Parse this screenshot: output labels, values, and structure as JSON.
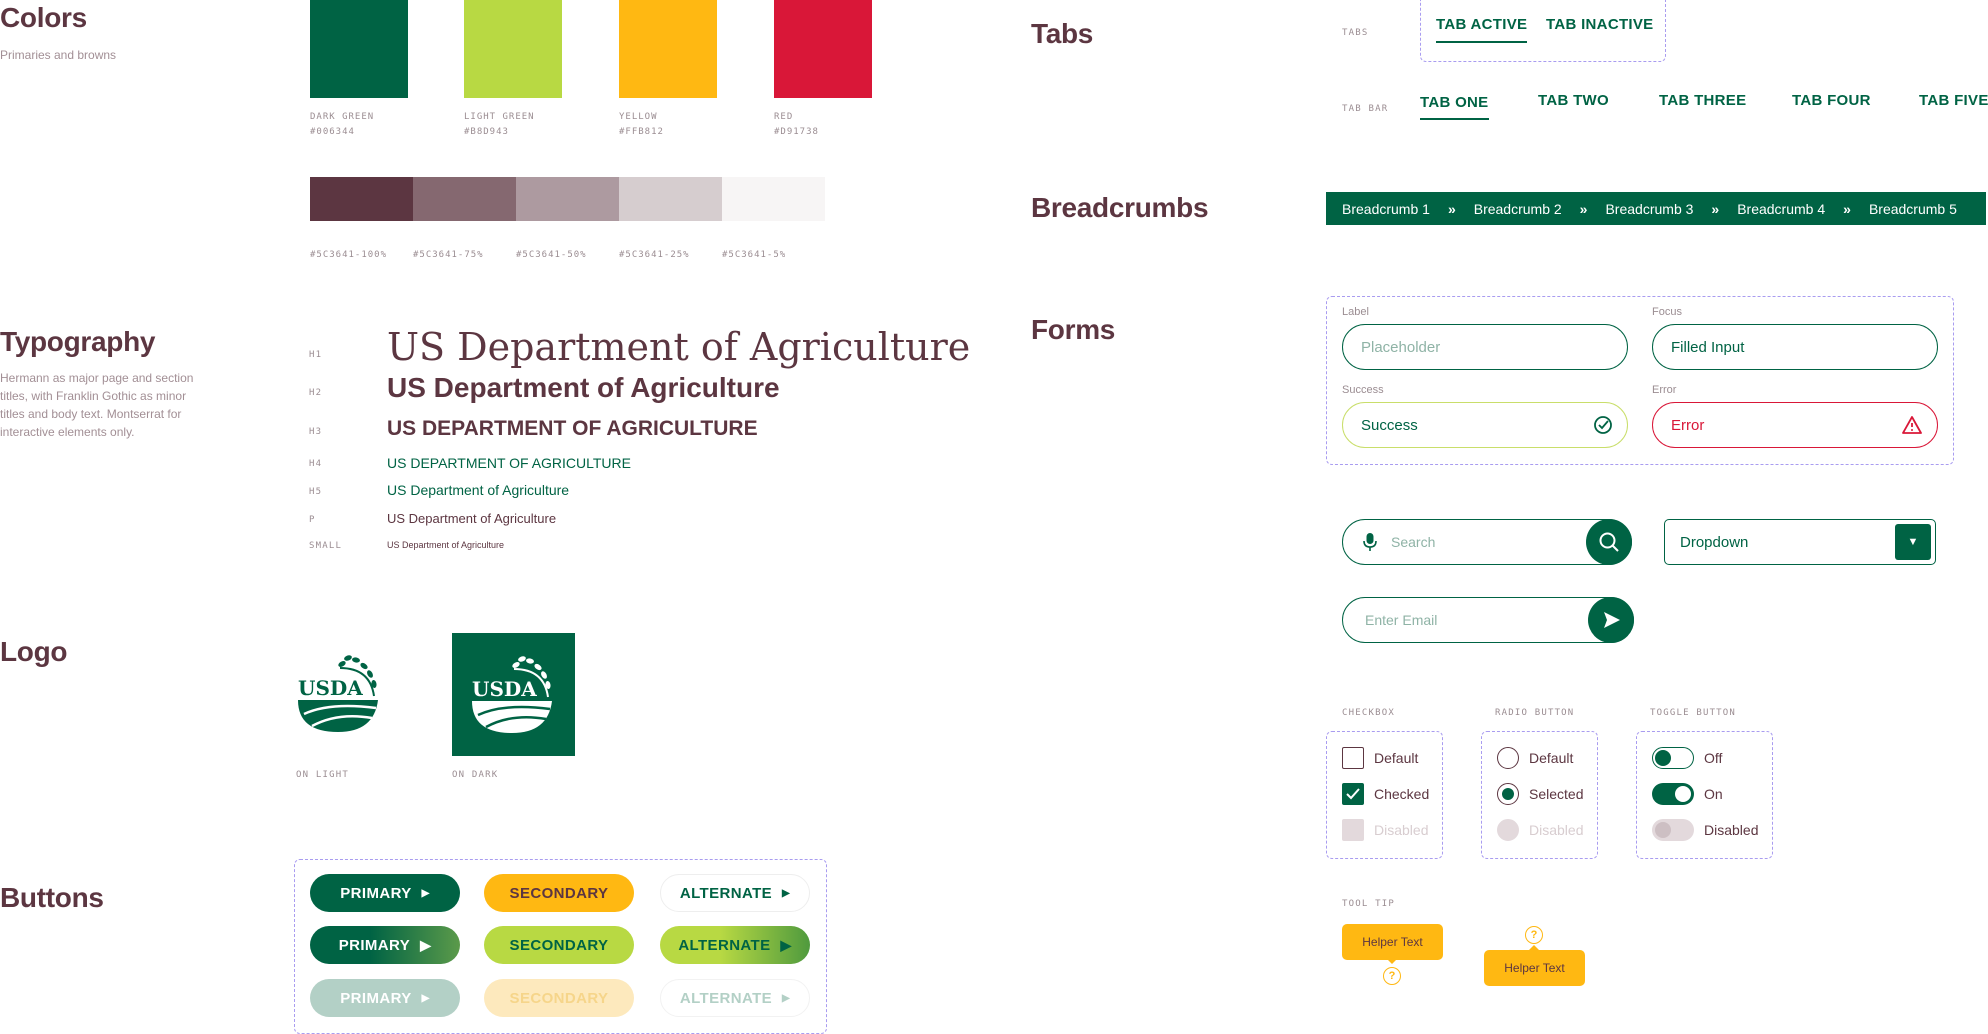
{
  "colors_section": {
    "title": "Colors",
    "subtitle": "Primaries and browns",
    "swatches": [
      {
        "name": "DARK GREEN",
        "hex": "#006344"
      },
      {
        "name": "LIGHT GREEN",
        "hex": "#B8D943"
      },
      {
        "name": "YELLOW",
        "hex": "#FFB812"
      },
      {
        "name": "RED",
        "hex": "#D91738"
      }
    ],
    "browns": [
      {
        "label": "#5C3641-100%",
        "color": "#5C3641"
      },
      {
        "label": "#5C3641-75%",
        "color": "#856870"
      },
      {
        "label": "#5C3641-50%",
        "color": "#ad9aa0"
      },
      {
        "label": "#5C3641-25%",
        "color": "#d6cdcf"
      },
      {
        "label": "#5C3641-5%",
        "color": "#f7f5f5"
      }
    ]
  },
  "typography": {
    "title": "Typography",
    "description": "Hermann as major page and section titles, with Franklin Gothic as minor titles and body text. Montserrat for interactive elements only.",
    "samples": [
      {
        "tag": "H1",
        "text": "US Department of Agriculture"
      },
      {
        "tag": "H2",
        "text": "US Department of Agriculture"
      },
      {
        "tag": "H3",
        "text": "US DEPARTMENT OF AGRICULTURE"
      },
      {
        "tag": "H4",
        "text": "US DEPARTMENT OF AGRICULTURE"
      },
      {
        "tag": "H5",
        "text": "US Department of Agriculture"
      },
      {
        "tag": "P",
        "text": "US Department of Agriculture"
      },
      {
        "tag": "SMALL",
        "text": "US Department of Agriculture"
      }
    ]
  },
  "logo": {
    "title": "Logo",
    "wordmark": "USDA",
    "on_light": "ON LIGHT",
    "on_dark": "ON DARK"
  },
  "buttons": {
    "title": "Buttons",
    "primary": "PRIMARY",
    "secondary": "SECONDARY",
    "alternate": "ALTERNATE"
  },
  "tabs": {
    "title": "Tabs",
    "tabs_label": "TABS",
    "tab_active": "TAB ACTIVE",
    "tab_inactive": "TAB INACTIVE",
    "tabbar_label": "TAB BAR",
    "tabbar": [
      "TAB ONE",
      "TAB TWO",
      "TAB THREE",
      "TAB FOUR",
      "TAB FIVE"
    ]
  },
  "breadcrumbs": {
    "title": "Breadcrumbs",
    "items": [
      "Breadcrumb 1",
      "Breadcrumb 2",
      "Breadcrumb 3",
      "Breadcrumb 4",
      "Breadcrumb 5"
    ],
    "separator": "»"
  },
  "forms": {
    "title": "Forms",
    "label_label": "Label",
    "placeholder": "Placeholder",
    "focus_label": "Focus",
    "filled_value": "Filled Input",
    "success_label": "Success",
    "success_value": "Success",
    "error_label": "Error",
    "error_value": "Error",
    "search_placeholder": "Search",
    "dropdown_value": "Dropdown",
    "email_placeholder": "Enter Email"
  },
  "controls": {
    "checkbox_label": "CHECKBOX",
    "radio_label": "RADIO BUTTON",
    "toggle_label": "TOGGLE BUTTON",
    "checkbox": [
      "Default",
      "Checked",
      "Disabled"
    ],
    "radio": [
      "Default",
      "Selected",
      "Disabled"
    ],
    "toggle": [
      "Off",
      "On",
      "Disabled"
    ]
  },
  "tooltip": {
    "label": "TOOL TIP",
    "text": "Helper Text",
    "qmark": "?"
  }
}
